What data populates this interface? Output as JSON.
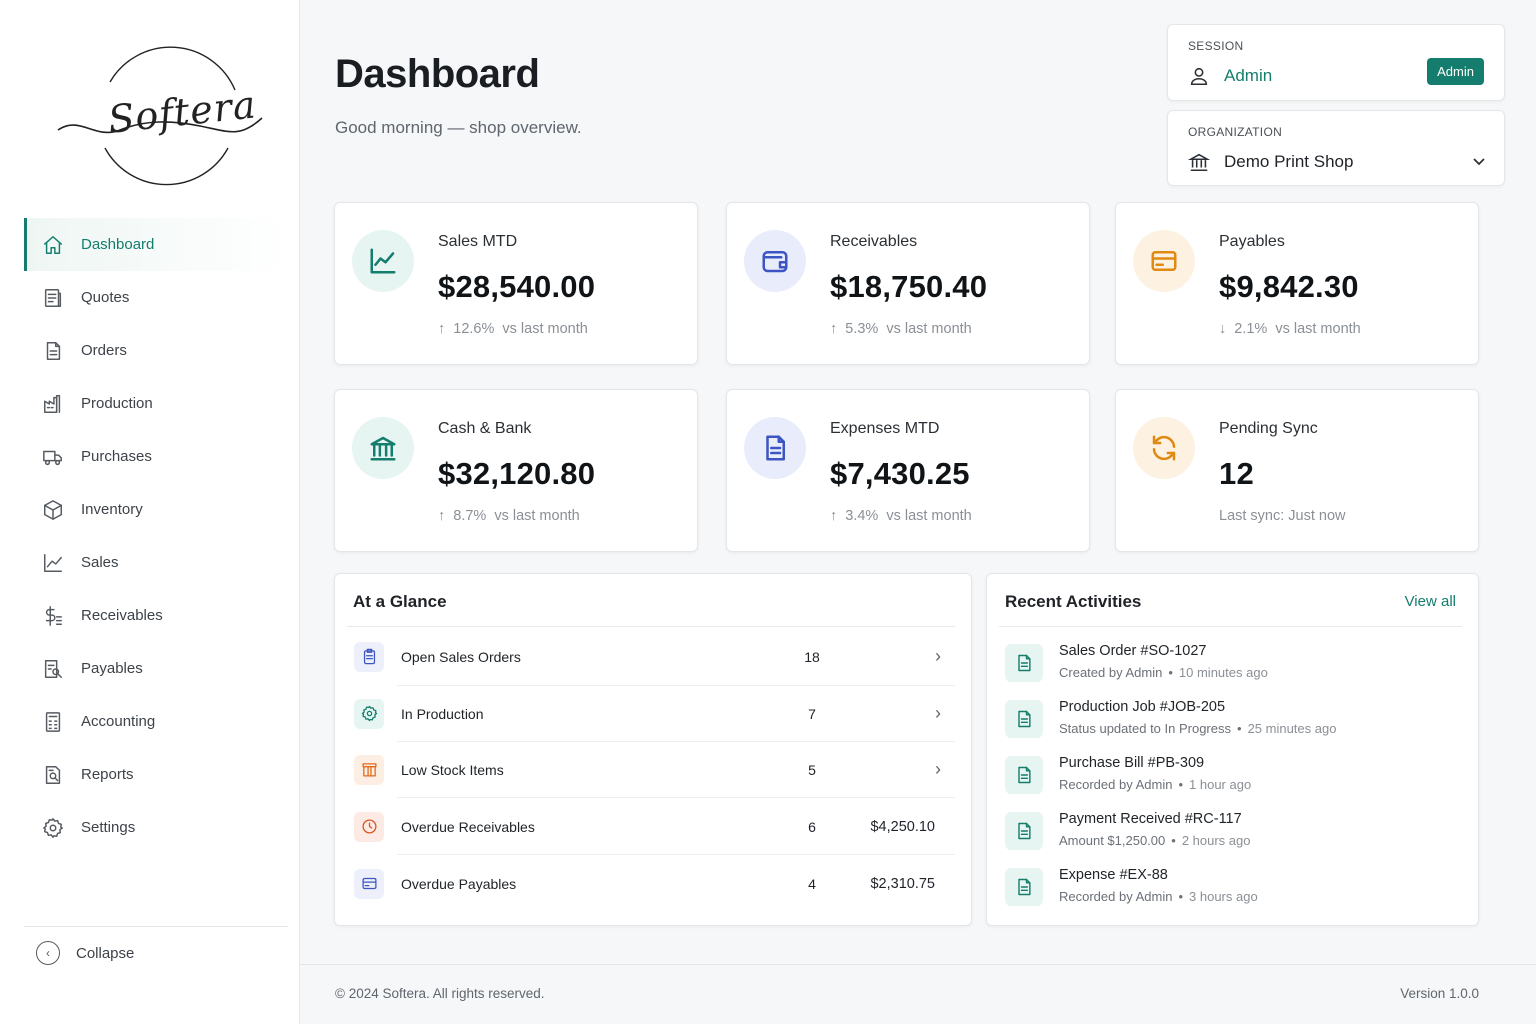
{
  "brand": {
    "logo_text": "Softera"
  },
  "sidebar": {
    "items": [
      {
        "label": "Dashboard",
        "icon": "home-icon"
      },
      {
        "label": "Quotes",
        "icon": "quote-icon"
      },
      {
        "label": "Orders",
        "icon": "document-icon"
      },
      {
        "label": "Production",
        "icon": "factory-icon"
      },
      {
        "label": "Purchases",
        "icon": "truck-icon"
      },
      {
        "label": "Inventory",
        "icon": "box-icon"
      },
      {
        "label": "Sales",
        "icon": "chart-line-icon"
      },
      {
        "label": "Receivables",
        "icon": "dollar-icon"
      },
      {
        "label": "Payables",
        "icon": "payables-icon"
      },
      {
        "label": "Accounting",
        "icon": "calculator-icon"
      },
      {
        "label": "Reports",
        "icon": "reports-icon"
      },
      {
        "label": "Settings",
        "icon": "gear-icon"
      }
    ],
    "active": "Dashboard",
    "collapse_label": "Collapse"
  },
  "header": {
    "title": "Dashboard",
    "subtitle": "Good morning — shop overview."
  },
  "session": {
    "label": "SESSION",
    "user": "Admin",
    "role_badge": "Admin"
  },
  "organization": {
    "label": "ORGANIZATION",
    "name": "Demo Print Shop"
  },
  "stats": [
    {
      "label": "Sales MTD",
      "value": "$28,540.00",
      "trend_arrow": "↑",
      "trend_pct": "12.6%",
      "trend_text": "vs last month",
      "trend_color": "#147d6d"
    },
    {
      "label": "Receivables",
      "value": "$18,750.40",
      "trend_arrow": "↑",
      "trend_pct": "5.3%",
      "trend_text": "vs last month",
      "trend_color": "#d9541e"
    },
    {
      "label": "Payables",
      "value": "$9,842.30",
      "trend_arrow": "↓",
      "trend_pct": "2.1%",
      "trend_text": "vs last month",
      "trend_color": "#147d6d"
    },
    {
      "label": "Cash & Bank",
      "value": "$32,120.80",
      "trend_arrow": "↑",
      "trend_pct": "8.7%",
      "trend_text": "vs last month",
      "trend_color": "#147d6d"
    },
    {
      "label": "Expenses MTD",
      "value": "$7,430.25",
      "trend_arrow": "↑",
      "trend_pct": "3.4%",
      "trend_text": "vs last month",
      "trend_color": "#d9541e"
    },
    {
      "label": "Pending Sync",
      "value": "12",
      "sync_text": "Last sync: Just now"
    }
  ],
  "glance": {
    "title": "At a Glance",
    "rows": [
      {
        "label": "Open Sales Orders",
        "count": "18",
        "amount": "",
        "icon": "clipboard-icon"
      },
      {
        "label": "In Production",
        "count": "7",
        "amount": "",
        "icon": "gear-icon"
      },
      {
        "label": "Low Stock Items",
        "count": "5",
        "amount": "",
        "icon": "package-icon"
      },
      {
        "label": "Overdue Receivables",
        "count": "6",
        "amount": "$4,250.10",
        "icon": "clock-icon"
      },
      {
        "label": "Overdue Payables",
        "count": "4",
        "amount": "$2,310.75",
        "icon": "card-icon"
      }
    ]
  },
  "recent": {
    "title": "Recent Activities",
    "view_all": "View all",
    "items": [
      {
        "title": "Sales Order #SO-1027",
        "detail": "Created by Admin",
        "time": "10 minutes ago"
      },
      {
        "title": "Production Job #JOB-205",
        "detail": "Status updated to In Progress",
        "time": "25 minutes ago"
      },
      {
        "title": "Purchase Bill #PB-309",
        "detail": "Recorded by Admin",
        "time": "1 hour ago"
      },
      {
        "title": "Payment Received #RC-117",
        "detail": "Amount $1,250.00",
        "time": "2 hours ago"
      },
      {
        "title": "Expense #EX-88",
        "detail": "Recorded by Admin",
        "time": "3 hours ago"
      }
    ]
  },
  "footer": {
    "copyright": "© 2024 Softera. All rights reserved.",
    "version": "Version 1.0.0"
  },
  "colors": {
    "accent": "#147d6d",
    "negative": "#d9541e",
    "blue": "#3c55c2",
    "amber": "#e08a12"
  }
}
